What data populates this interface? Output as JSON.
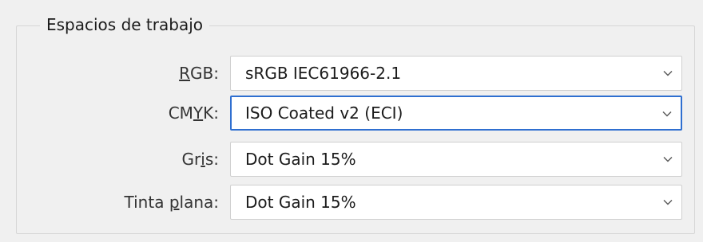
{
  "group": {
    "title": "Espacios de trabajo"
  },
  "rows": [
    {
      "label_mn": "R",
      "label_rest": "GB:",
      "value": "sRGB IEC61966-2.1"
    },
    {
      "label_pre": "CM",
      "label_mn": "Y",
      "label_rest": "K:",
      "value": "ISO Coated v2 (ECI)"
    },
    {
      "label_pre": "Gr",
      "label_mn": "i",
      "label_rest": "s:",
      "value": "Dot Gain 15%"
    },
    {
      "label_pre": "Tinta ",
      "label_mn": "p",
      "label_rest": "lana:",
      "value": "Dot Gain 15%"
    }
  ],
  "icons": {
    "dropdown": "chevron-down-icon"
  },
  "colors": {
    "focus_border": "#2f6fd0"
  }
}
